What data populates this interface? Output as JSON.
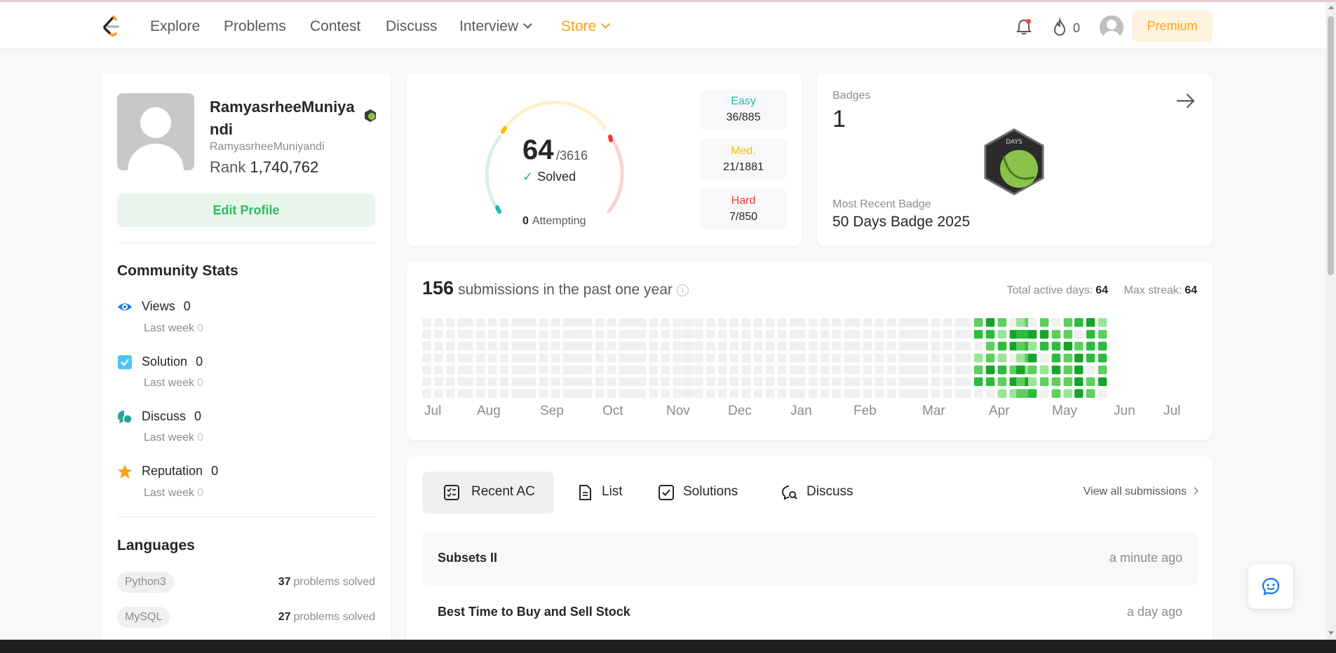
{
  "nav": {
    "items": [
      "Explore",
      "Problems",
      "Contest",
      "Discuss"
    ],
    "interview": "Interview",
    "store": "Store",
    "streak_count": "0",
    "premium": "Premium"
  },
  "profile": {
    "display_name": "RamyasrheeMuniyandi",
    "username": "RamyasrheeMuniyandi",
    "rank_label": "Rank",
    "rank": "1,740,762",
    "edit_profile": "Edit Profile"
  },
  "community": {
    "title": "Community Stats",
    "stats": [
      {
        "label": "Views",
        "value": "0",
        "sub_label": "Last week",
        "sub_value": "0",
        "color": "#1a73e8"
      },
      {
        "label": "Solution",
        "value": "0",
        "sub_label": "Last week",
        "sub_value": "0",
        "color": "#4fc3f7"
      },
      {
        "label": "Discuss",
        "value": "0",
        "sub_label": "Last week",
        "sub_value": "0",
        "color": "#26a69a"
      },
      {
        "label": "Reputation",
        "value": "0",
        "sub_label": "Last week",
        "sub_value": "0",
        "color": "#ffa116"
      }
    ]
  },
  "languages": {
    "title": "Languages",
    "suffix": "problems solved",
    "items": [
      {
        "name": "Python3",
        "count": "37"
      },
      {
        "name": "MySQL",
        "count": "27"
      }
    ]
  },
  "solved": {
    "solved": "64",
    "total": "/3616",
    "solved_label": "Solved",
    "attempting_count": "0",
    "attempting_label": "Attempting",
    "difficulties": [
      {
        "label": "Easy",
        "count": "36/885",
        "color": "#1cbaba"
      },
      {
        "label": "Med.",
        "count": "21/1881",
        "color": "#ffb700"
      },
      {
        "label": "Hard",
        "count": "7/850",
        "color": "#f63737"
      }
    ]
  },
  "badges": {
    "title": "Badges",
    "count": "1",
    "badge_text": "DAYS",
    "recent_label": "Most Recent Badge",
    "recent_name": "50 Days Badge 2025"
  },
  "submissions": {
    "count": "156",
    "label": "submissions in the past one year",
    "total_active_label": "Total active days:",
    "total_active": "64",
    "max_streak_label": "Max streak:",
    "max_streak": "64",
    "months": [
      "Jul",
      "Aug",
      "Sep",
      "Oct",
      "Nov",
      "Dec",
      "Jan",
      "Feb",
      "Mar",
      "Apr",
      "May",
      "Jun",
      "Jul"
    ]
  },
  "recent": {
    "tabs": [
      "Recent AC",
      "List",
      "Solutions",
      "Discuss"
    ],
    "view_all": "View all submissions",
    "rows": [
      {
        "problem": "Subsets II",
        "time": "a minute ago"
      },
      {
        "problem": "Best Time to Buy and Sell Stock",
        "time": "a day ago"
      }
    ]
  }
}
